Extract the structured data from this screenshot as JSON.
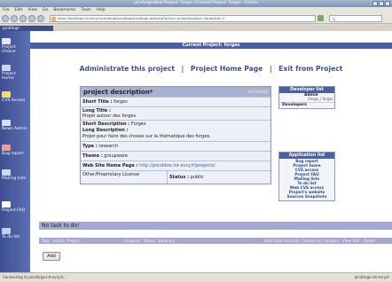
{
  "browser": {
    "title": "picoforge/New Project: Forge! (Current Project: forges - Firefox",
    "menu": [
      "File",
      "Edit",
      "View",
      "Go",
      "Bookmarks",
      "Tools",
      "Help"
    ],
    "url": "https://picoforge.int-evry.fr/picoforge/picoforge/picoforge-web.php?action=project&project=forges&id=1",
    "search_placeholder": "G",
    "tab": "picoforge",
    "status_left": "Connecting to picoforge.int-evry.fr...",
    "status_right": "picoforge.int-evry.fr"
  },
  "sidebar": {
    "items": [
      {
        "label": "Project Choice",
        "icon": "home-icon",
        "color": "#e0e7ff"
      },
      {
        "label": "Project Home",
        "icon": "house-icon",
        "color": "#c9d3f5"
      },
      {
        "label": "CVS Access",
        "icon": "cvs-icon",
        "color": "#f3d97a"
      },
      {
        "label": "News Admin",
        "icon": "news-icon",
        "color": "#d7def9"
      },
      {
        "label": "Bug report",
        "icon": "bug-icon",
        "color": "#f29a9a"
      },
      {
        "label": "Mailing lists",
        "icon": "mail-icon",
        "color": "#cdd7f6"
      },
      {
        "label": "Project FAQ",
        "icon": "faq-icon",
        "color": "#ffffff"
      },
      {
        "label": "To do list",
        "icon": "todo-icon",
        "color": "#c4cdee"
      }
    ]
  },
  "header": {
    "current_project": "Current Project: forges"
  },
  "admin_links": {
    "administrate": "Administrate this project",
    "home": "Project Home Page",
    "exit": "Exit from Project",
    "separator": "|"
  },
  "description": {
    "title": "project description*",
    "meta": "24/11/2004",
    "short_title_label": "Short Title :",
    "short_title": "forges",
    "long_title_label": "Long Title :",
    "long_title": "Projet autour des forges",
    "short_desc_label": "Short Description :",
    "short_desc": "Forges",
    "long_desc_label": "Long Description :",
    "long_desc": "Projet pour faire des choses sur la thématique des forges.",
    "type_label": "Type :",
    "type": "research",
    "theme_label": "Theme :",
    "theme": "groupware",
    "website_label": "Web Site Home Page :",
    "website": "http://picolibre.int-evry.fr/projects/",
    "license": "Other/Proprietary License",
    "status_label": "Status :",
    "status": "public"
  },
  "developer_list": {
    "title": "Developer list",
    "admin_role": "Admin",
    "admin_name": "(forge_/ forge)",
    "developers_label": "Developers"
  },
  "application_list": {
    "title": "Application list",
    "items": [
      "Bug report",
      "Project home",
      "CVS access",
      "Project FAQ",
      "Mailing lists",
      "To do list",
      "Web CVS access",
      "Project's website",
      "Sources Snapshots"
    ]
  },
  "tasks": {
    "empty_message": "No task to do!",
    "columns": [
      "Task",
      "Action",
      "Project",
      "Assigned",
      "Status",
      "Summary",
      "Start Date",
      "End date",
      "Created by",
      "Category",
      "View",
      "Edit",
      "Delete"
    ],
    "add_label": "Add"
  }
}
